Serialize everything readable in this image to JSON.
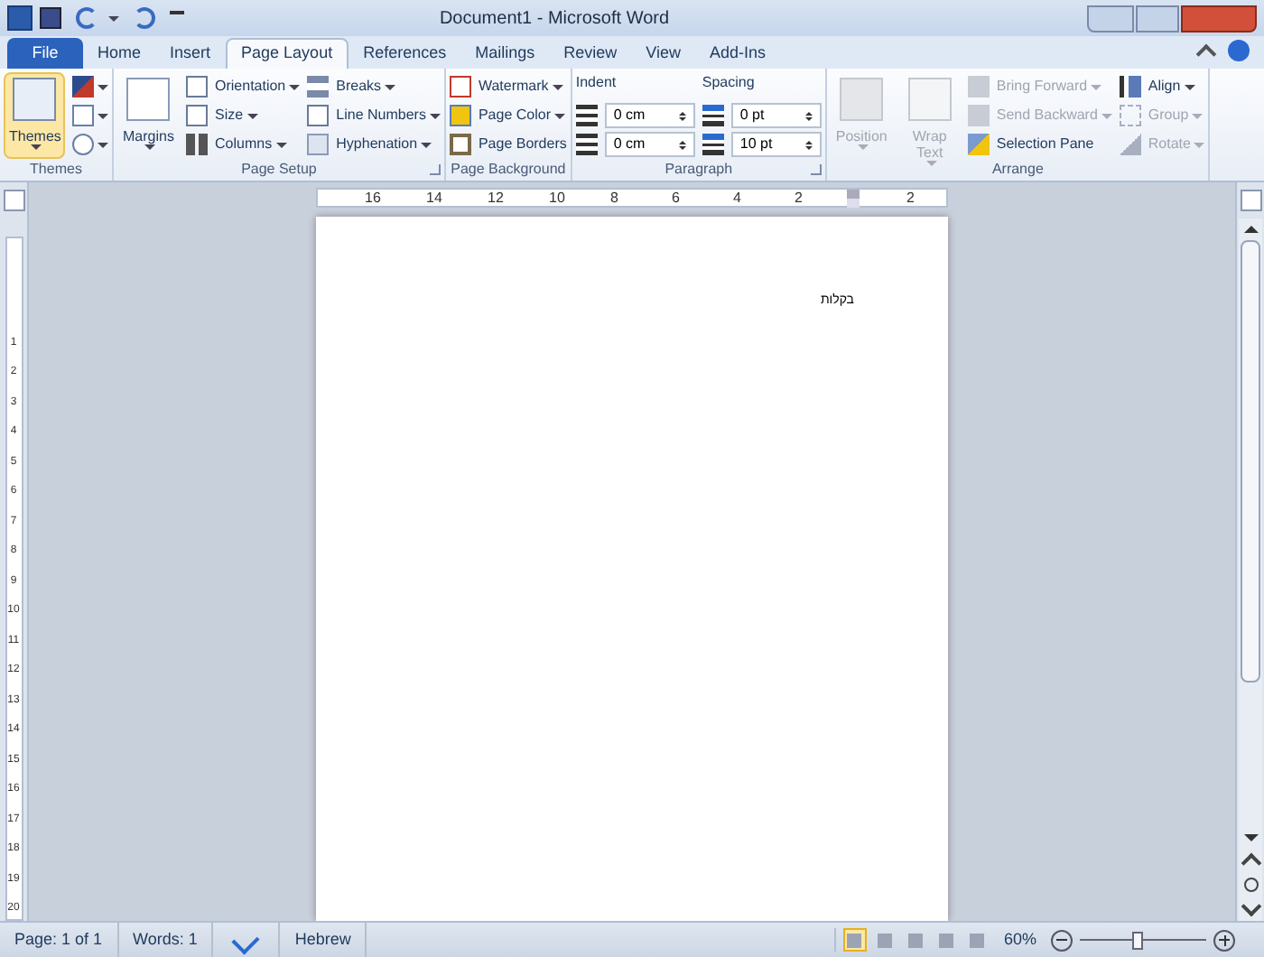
{
  "window": {
    "title": "Document1 - Microsoft Word"
  },
  "tabs": [
    {
      "label": "File",
      "kind": "file",
      "selected": false
    },
    {
      "label": "Home",
      "kind": "tab",
      "selected": false
    },
    {
      "label": "Insert",
      "kind": "tab",
      "selected": false
    },
    {
      "label": "Page Layout",
      "kind": "tab",
      "selected": true
    },
    {
      "label": "References",
      "kind": "tab",
      "selected": false
    },
    {
      "label": "Mailings",
      "kind": "tab",
      "selected": false
    },
    {
      "label": "Review",
      "kind": "tab",
      "selected": false
    },
    {
      "label": "View",
      "kind": "tab",
      "selected": false
    },
    {
      "label": "Add-Ins",
      "kind": "tab",
      "selected": false
    }
  ],
  "ribbon": {
    "groups": [
      {
        "label": "Themes",
        "launcher": false,
        "columns": [
          [
            {
              "kind": "large",
              "label": "Themes",
              "dropdown": true,
              "disabled": false,
              "selected": true
            }
          ],
          [
            {
              "kind": "icon",
              "dropdown": true,
              "disabled": false
            },
            {
              "kind": "icon",
              "dropdown": true,
              "disabled": false
            },
            {
              "kind": "icon",
              "dropdown": true,
              "disabled": false
            }
          ]
        ]
      },
      {
        "label": "Page Setup",
        "launcher": true,
        "columns": [
          [
            {
              "kind": "large",
              "label": "Margins",
              "dropdown": true,
              "disabled": false,
              "selected": false
            }
          ],
          [
            {
              "kind": "small",
              "label": "Orientation",
              "dropdown": true,
              "disabled": false
            },
            {
              "kind": "small",
              "label": "Size",
              "dropdown": true,
              "disabled": false
            },
            {
              "kind": "small",
              "label": "Columns",
              "dropdown": true,
              "disabled": false
            }
          ],
          [
            {
              "kind": "small",
              "label": "Breaks",
              "dropdown": true,
              "disabled": false
            },
            {
              "kind": "small",
              "label": "Line Numbers",
              "dropdown": true,
              "disabled": false
            },
            {
              "kind": "small",
              "label": "Hyphenation",
              "dropdown": true,
              "disabled": false
            }
          ]
        ]
      },
      {
        "label": "Page Background",
        "launcher": false,
        "columns": [
          [
            {
              "kind": "small",
              "label": "Watermark",
              "dropdown": true,
              "disabled": false
            },
            {
              "kind": "small",
              "label": "Page Color",
              "dropdown": true,
              "disabled": false
            },
            {
              "kind": "small",
              "label": "Page Borders",
              "dropdown": false,
              "disabled": false
            }
          ]
        ]
      },
      {
        "label": "Paragraph",
        "launcher": true,
        "columns": [
          [
            {
              "kind": "heading",
              "label": "Indent"
            },
            {
              "kind": "spin",
              "value": "0 cm"
            },
            {
              "kind": "spin",
              "value": "0 cm"
            }
          ],
          [
            {
              "kind": "heading",
              "label": "Spacing"
            },
            {
              "kind": "spin",
              "value": "0 pt"
            },
            {
              "kind": "spin",
              "value": "10 pt"
            }
          ]
        ]
      },
      {
        "label": "Arrange",
        "launcher": false,
        "columns": [
          [
            {
              "kind": "large",
              "label": "Position",
              "dropdown": true,
              "disabled": true,
              "selected": false
            }
          ],
          [
            {
              "kind": "large",
              "label": "Wrap Text",
              "dropdown": true,
              "disabled": true,
              "selected": false
            }
          ],
          [
            {
              "kind": "small",
              "label": "Bring Forward",
              "dropdown": true,
              "disabled": true
            },
            {
              "kind": "small",
              "label": "Send Backward",
              "dropdown": true,
              "disabled": true
            },
            {
              "kind": "small",
              "label": "Selection Pane",
              "dropdown": false,
              "disabled": false
            }
          ],
          [
            {
              "kind": "small",
              "label": "Align",
              "dropdown": true,
              "disabled": false
            },
            {
              "kind": "small",
              "label": "Group",
              "dropdown": true,
              "disabled": true
            },
            {
              "kind": "small",
              "label": "Rotate",
              "dropdown": true,
              "disabled": true
            }
          ]
        ]
      }
    ]
  },
  "ruler": {
    "labels": [
      "16",
      "14",
      "12",
      "10",
      "8",
      "6",
      "4",
      "2",
      "2"
    ]
  },
  "vertical_ruler": {
    "labels": [
      "1",
      "2",
      "3",
      "4",
      "5",
      "6",
      "7",
      "8",
      "9",
      "10",
      "11",
      "12",
      "13",
      "14",
      "15",
      "16",
      "17",
      "18",
      "19",
      "20"
    ]
  },
  "document": {
    "text": "בקלות"
  },
  "status_bar": {
    "items": [
      {
        "kind": "text",
        "label": "Page: 1 of 1"
      },
      {
        "kind": "text",
        "label": "Words: 1"
      },
      {
        "kind": "proofing"
      },
      {
        "kind": "text",
        "label": "Hebrew"
      }
    ],
    "views": [
      {
        "selected": true
      },
      {
        "selected": false
      },
      {
        "selected": false
      },
      {
        "selected": false
      },
      {
        "selected": false
      }
    ],
    "zoom": "60%",
    "zoom_level": {
      "level": 0.45
    }
  }
}
